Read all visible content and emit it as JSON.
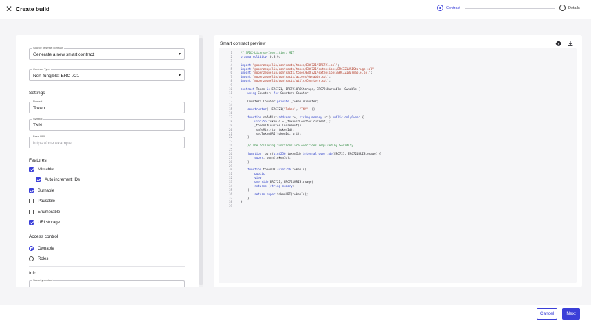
{
  "header": {
    "title": "Create build",
    "steps": [
      {
        "label": "Contract",
        "active": true
      },
      {
        "label": "Details",
        "active": false
      }
    ]
  },
  "form": {
    "source": {
      "label": "Source of smart contract",
      "value": "Generate a new smart contract"
    },
    "contract_type": {
      "label": "Contract Type",
      "value": "Non-fungible: ERC-721"
    },
    "settings_heading": "Settings",
    "name": {
      "label": "Name *",
      "value": "Token"
    },
    "symbol": {
      "label": "Symbol",
      "value": "TKN"
    },
    "base_uri": {
      "label": "Base URI",
      "placeholder": "https://one.example"
    },
    "features_heading": "Features",
    "features": [
      {
        "label": "Mintable",
        "checked": true
      },
      {
        "label": "Auto increment IDs",
        "checked": true
      },
      {
        "label": "Burnable",
        "checked": true
      },
      {
        "label": "Pausable",
        "checked": false
      },
      {
        "label": "Enumerable",
        "checked": false
      },
      {
        "label": "URI storage",
        "checked": true
      }
    ],
    "access_heading": "Access control",
    "access": [
      {
        "label": "Ownable",
        "selected": true
      },
      {
        "label": "Roles",
        "selected": false
      }
    ],
    "info_heading": "Info",
    "security_contact": {
      "label": "Security contact"
    }
  },
  "preview": {
    "title": "Smart contract preview",
    "icons": [
      "cloud-download-icon",
      "download-icon"
    ],
    "lines": [
      "// SPDX-License-Identifier: MIT",
      "pragma solidity ^0.8.9;",
      "",
      "import \"@openzeppelin/contracts/token/ERC721/ERC721.sol\";",
      "import \"@openzeppelin/contracts/token/ERC721/extensions/ERC721URIStorage.sol\";",
      "import \"@openzeppelin/contracts/token/ERC721/extensions/ERC721Burnable.sol\";",
      "import \"@openzeppelin/contracts/access/Ownable.sol\";",
      "import \"@openzeppelin/contracts/utils/Counters.sol\";",
      "",
      "contract Token is ERC721, ERC721URIStorage, ERC721Burnable, Ownable {",
      "    using Counters for Counters.Counter;",
      "",
      "    Counters.Counter private _tokenIdCounter;",
      "",
      "    constructor() ERC721(\"Token\", \"TKN\") {}",
      "",
      "    function safeMint(address to, string memory uri) public onlyOwner {",
      "        uint256 tokenId = _tokenIdCounter.current();",
      "        _tokenIdCounter.increment();",
      "        _safeMint(to, tokenId);",
      "        _setTokenURI(tokenId, uri);",
      "    }",
      "",
      "    // The following functions are overrides required by Solidity.",
      "",
      "    function _burn(uint256 tokenId) internal override(ERC721, ERC721URIStorage) {",
      "        super._burn(tokenId);",
      "    }",
      "",
      "    function tokenURI(uint256 tokenId)",
      "        public",
      "        view",
      "        override(ERC721, ERC721URIStorage)",
      "        returns (string memory)",
      "    {",
      "        return super.tokenURI(tokenId);",
      "    }",
      "}",
      ""
    ]
  },
  "footer": {
    "cancel_label": "Cancel",
    "next_label": "Next"
  },
  "colors": {
    "accent": "#3b3fd8",
    "background": "#f5f5f7"
  }
}
